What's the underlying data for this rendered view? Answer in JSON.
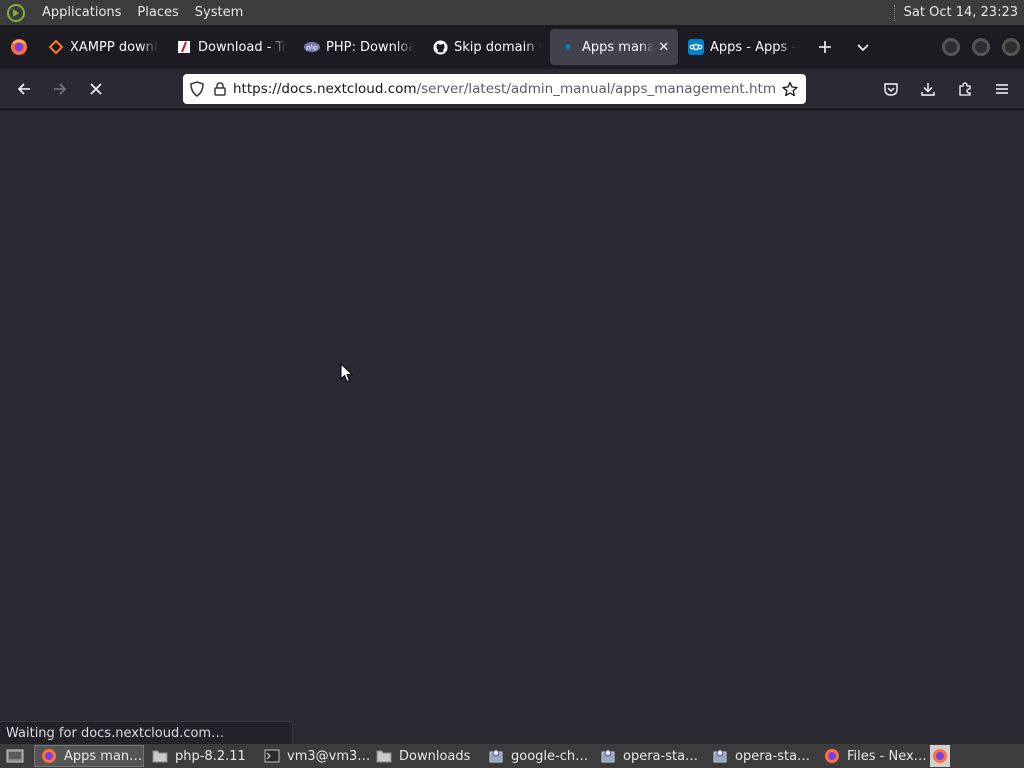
{
  "top_panel": {
    "menus": [
      "Applications",
      "Places",
      "System"
    ],
    "clock": "Sat Oct 14, 23:23"
  },
  "tabs": [
    {
      "label": "XAMPP downl",
      "icon": "xampp-icon",
      "color": "#fb7a24",
      "active": false
    },
    {
      "label": "Download - Tr",
      "icon": "download-page-icon",
      "color": "#d0102c",
      "active": false
    },
    {
      "label": "PHP: Downloa",
      "icon": "php-icon",
      "color": "#777bb3",
      "active": false
    },
    {
      "label": "Skip domain v",
      "icon": "github-icon",
      "color": "#ffffff",
      "active": false
    },
    {
      "label": "Apps manag",
      "icon": "loading-icon",
      "color": "#0082c9",
      "active": true
    },
    {
      "label": "Apps - Apps -",
      "icon": "nextcloud-icon",
      "color": "#0082c9",
      "active": false
    }
  ],
  "nav": {
    "url_domain": "https://docs.nextcloud.com",
    "url_path": "/server/latest/admin_manual/apps_management.html"
  },
  "status": {
    "text": "Waiting for docs.nextcloud.com…"
  },
  "taskbar": {
    "items": [
      {
        "label": "Apps man…",
        "icon": "firefox-icon",
        "active": true
      },
      {
        "label": "php-8.2.11",
        "icon": "folder-icon",
        "active": false
      },
      {
        "label": "vm3@vm3…",
        "icon": "terminal-icon",
        "active": false
      },
      {
        "label": "Downloads",
        "icon": "folder-icon",
        "active": false
      },
      {
        "label": "google-ch…",
        "icon": "installer-icon",
        "active": false
      },
      {
        "label": "opera-sta…",
        "icon": "installer-icon",
        "active": false
      },
      {
        "label": "opera-sta…",
        "icon": "installer-icon",
        "active": false
      },
      {
        "label": "Files - Nex…",
        "icon": "firefox-icon",
        "active": false
      }
    ]
  }
}
